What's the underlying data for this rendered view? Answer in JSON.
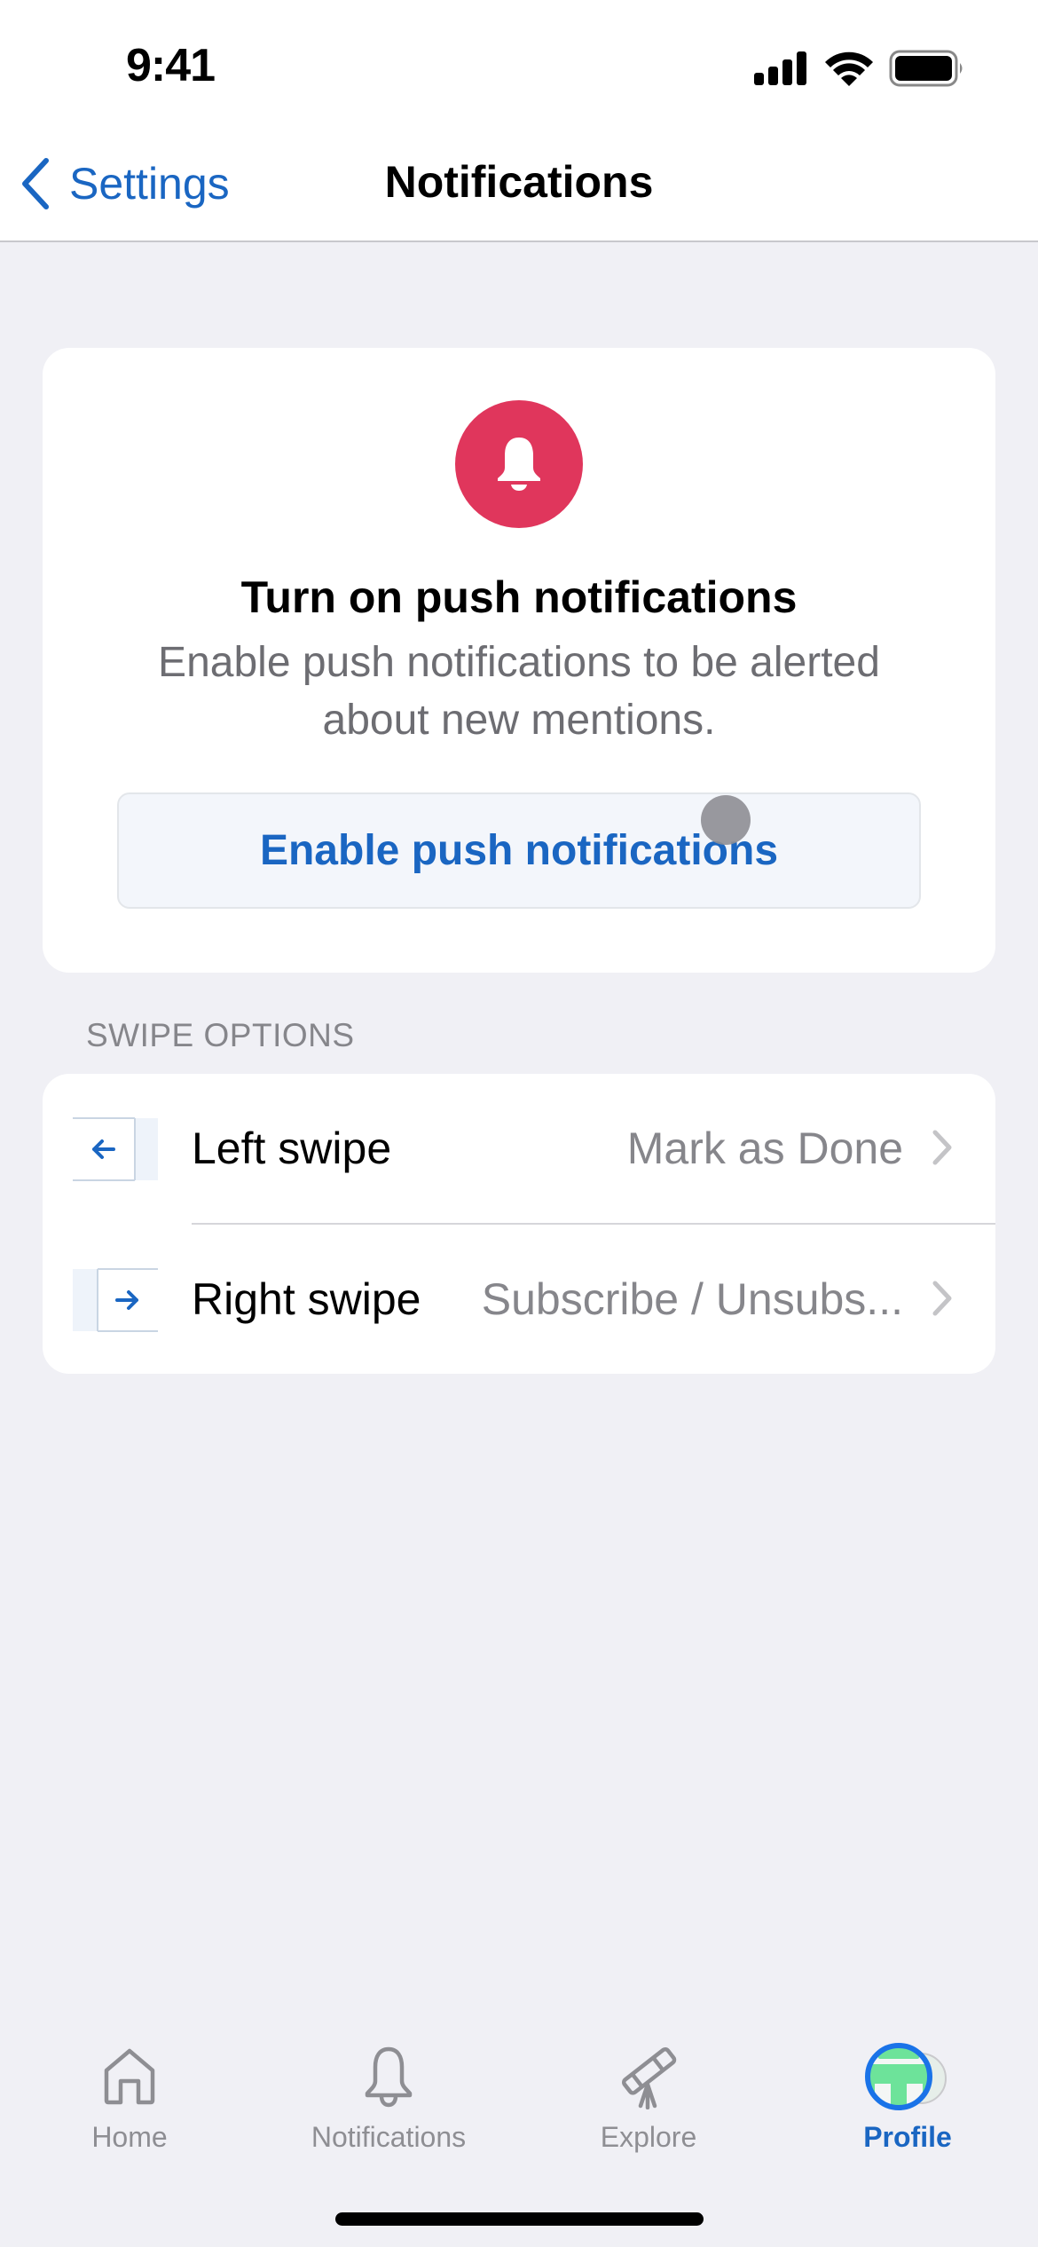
{
  "status_bar": {
    "time": "9:41",
    "icons": [
      "cellular-signal-icon",
      "wifi-icon",
      "battery-icon"
    ]
  },
  "nav": {
    "back_label": "Settings",
    "back_icon": "chevron-left-icon",
    "title": "Notifications"
  },
  "push_card": {
    "icon": "bell-icon",
    "icon_color": "#E0365C",
    "title": "Turn on push notifications",
    "body": "Enable push notifications to be alerted about new mentions.",
    "button_label": "Enable push notifications"
  },
  "swipe_options": {
    "header": "SWIPE OPTIONS",
    "rows": [
      {
        "label": "Left swipe",
        "value": "Mark as Done",
        "icon": "arrow-left-icon"
      },
      {
        "label": "Right swipe",
        "value": "Subscribe / Unsubs...",
        "icon": "arrow-right-icon"
      }
    ]
  },
  "tab_bar": {
    "tabs": [
      {
        "label": "Home",
        "icon": "home-icon",
        "active": false
      },
      {
        "label": "Notifications",
        "icon": "bell-outline-icon",
        "active": false
      },
      {
        "label": "Explore",
        "icon": "telescope-icon",
        "active": false
      },
      {
        "label": "Profile",
        "icon": "avatar-icon",
        "active": true
      }
    ]
  },
  "colors": {
    "accent": "#1A66C2",
    "background": "#F0F0F5",
    "secondary_text": "#86868B",
    "avatar_green": "#6DE39A"
  }
}
